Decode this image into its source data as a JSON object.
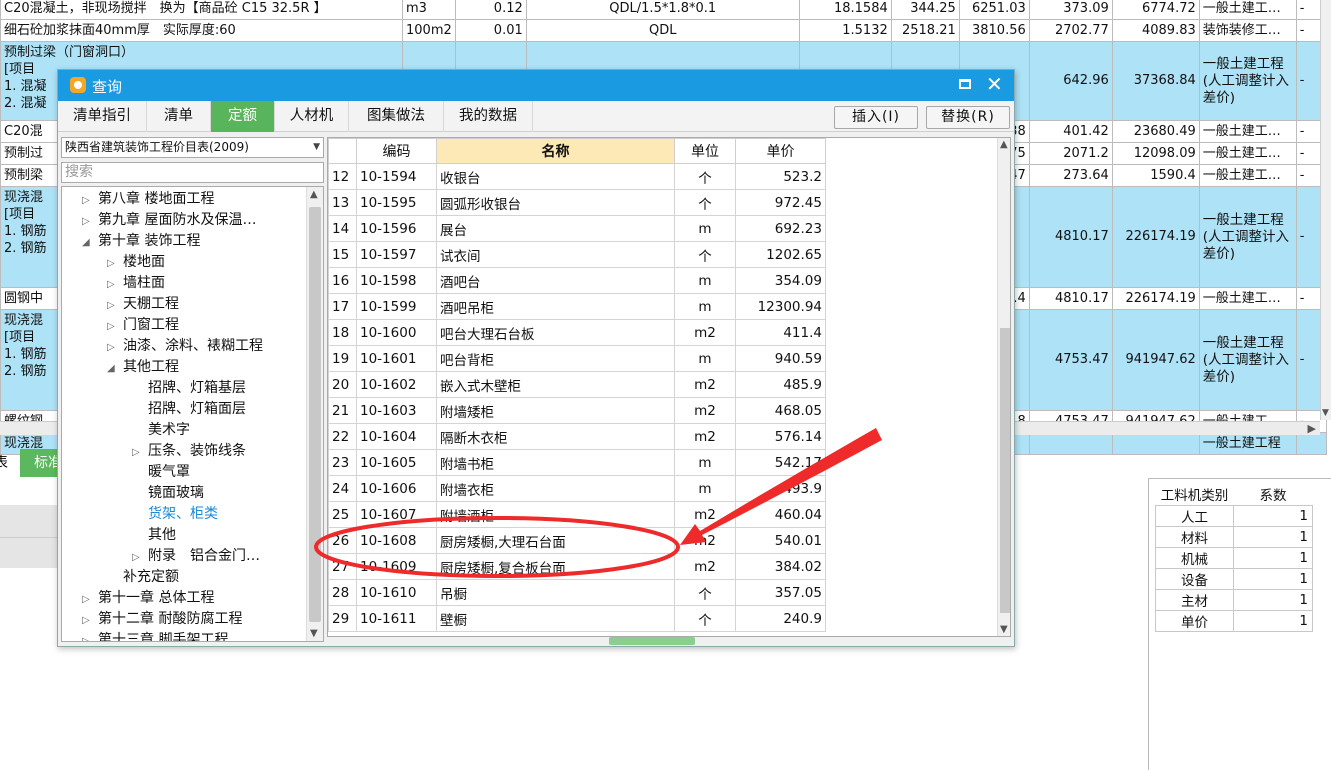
{
  "bg_rows": [
    {
      "style": "normal",
      "cols": [
        "C20混凝土，非现场搅拌　换为【商品砼 C15 32.5R 】",
        "m3",
        "0.12",
        "QDL/1.5*1.8*0.1",
        "18.1584",
        "344.25",
        "6251.03",
        "373.09",
        "6774.72",
        "一般土建工…",
        "-"
      ]
    },
    {
      "style": "normal",
      "cols": [
        "细石砼加浆抹面40mm厚　实际厚度:60",
        "100m2",
        "0.01",
        "QDL",
        "1.5132",
        "2518.21",
        "3810.56",
        "2702.77",
        "4089.83",
        "装饰装修工…",
        "-"
      ]
    },
    {
      "style": "tall",
      "cols": [
        "预制过梁（门窗洞口）\n[项目\n1. 混凝\n2. 混凝",
        "",
        "",
        "",
        "",
        "",
        "",
        "642.96",
        "37368.84",
        "一般土建工程(人工调整计入差价)",
        "-"
      ]
    },
    {
      "style": "normal",
      "cols": [
        "C20混",
        "",
        "",
        "",
        "",
        "",
        "9.38",
        "401.42",
        "23680.49",
        "一般土建工…",
        "-"
      ]
    },
    {
      "style": "normal",
      "cols": [
        "预制过",
        "",
        "",
        "",
        "",
        "",
        "2.75",
        "2071.2",
        "12098.09",
        "一般土建工…",
        "-"
      ]
    },
    {
      "style": "normal",
      "cols": [
        "预制梁",
        "",
        "",
        "",
        "",
        "",
        "7.47",
        "273.64",
        "1590.4",
        "一般土建工…",
        "-"
      ]
    },
    {
      "style": "tall2",
      "cols": [
        "现浇混\n[项目\n1. 钢筋\n2. 钢筋",
        "",
        "",
        "",
        "",
        "",
        "",
        "4810.17",
        "226174.19",
        "一般土建工程(人工调整计入差价)",
        "-"
      ]
    },
    {
      "style": "normal",
      "cols": [
        "圆钢中",
        "",
        "",
        "",
        "",
        "",
        "38.4",
        "4810.17",
        "226174.19",
        "一般土建工…",
        "-"
      ]
    },
    {
      "style": "tall2",
      "cols": [
        "现浇混\n[项目\n1. 钢筋\n2. 钢筋",
        "",
        "",
        "",
        "",
        "",
        "",
        "4753.47",
        "941947.62",
        "一般土建工程(人工调整计入差价)",
        "-"
      ]
    },
    {
      "style": "normal",
      "cols": [
        "螺纹钢",
        "",
        "",
        "",
        "",
        "",
        "25.8",
        "4753.47",
        "941947.62",
        "一般土建工…",
        "-"
      ]
    },
    {
      "style": "blue",
      "cols": [
        "现浇混",
        "",
        "",
        "",
        "",
        "",
        "",
        "",
        "",
        "一般土建工程",
        ""
      ]
    }
  ],
  "bg_tabs": [
    "表",
    "标准"
  ],
  "right_panel": {
    "headers": [
      "工料机类别",
      "系数"
    ],
    "rows": [
      {
        "type": "人工",
        "coef": "1"
      },
      {
        "type": "材料",
        "coef": "1"
      },
      {
        "type": "机械",
        "coef": "1"
      },
      {
        "type": "设备",
        "coef": "1"
      },
      {
        "type": "主材",
        "coef": "1"
      },
      {
        "type": "单价",
        "coef": "1"
      }
    ]
  },
  "dialog": {
    "title": "查询",
    "tabs": [
      "清单指引",
      "清单",
      "定额",
      "人材机",
      "图集做法",
      "我的数据"
    ],
    "active_tab": "定额",
    "insert_button": "插入(I)",
    "replace_button": "替换(R)",
    "library": "陕西省建筑装饰工程价目表(2009)",
    "search_placeholder": "搜索",
    "tree": [
      {
        "label": "第八章 楼地面工程",
        "level": 0,
        "toggle": "collapsed"
      },
      {
        "label": "第九章 屋面防水及保温…",
        "level": 0,
        "toggle": "collapsed"
      },
      {
        "label": "第十章 装饰工程",
        "level": 0,
        "toggle": "expanded"
      },
      {
        "label": "楼地面",
        "level": 1,
        "toggle": "collapsed"
      },
      {
        "label": "墙柱面",
        "level": 1,
        "toggle": "collapsed"
      },
      {
        "label": "天棚工程",
        "level": 1,
        "toggle": "collapsed"
      },
      {
        "label": "门窗工程",
        "level": 1,
        "toggle": "collapsed"
      },
      {
        "label": "油漆、涂料、裱糊工程",
        "level": 1,
        "toggle": "collapsed"
      },
      {
        "label": "其他工程",
        "level": 1,
        "toggle": "expanded"
      },
      {
        "label": "招牌、灯箱基层",
        "level": 2,
        "toggle": "none"
      },
      {
        "label": "招牌、灯箱面层",
        "level": 2,
        "toggle": "none"
      },
      {
        "label": "美术字",
        "level": 2,
        "toggle": "none"
      },
      {
        "label": "压条、装饰线条",
        "level": 2,
        "toggle": "collapsed"
      },
      {
        "label": "暖气罩",
        "level": 2,
        "toggle": "none"
      },
      {
        "label": "镜面玻璃",
        "level": 2,
        "toggle": "none"
      },
      {
        "label": "货架、柜类",
        "level": 2,
        "toggle": "none",
        "selected": true
      },
      {
        "label": "其他",
        "level": 2,
        "toggle": "none"
      },
      {
        "label": "附录　铝合金门…",
        "level": 2,
        "toggle": "collapsed"
      },
      {
        "label": "补充定额",
        "level": 1,
        "toggle": "none"
      },
      {
        "label": "第十一章 总体工程",
        "level": 0,
        "toggle": "collapsed"
      },
      {
        "label": "第十二章 耐酸防腐工程",
        "level": 0,
        "toggle": "collapsed"
      },
      {
        "label": "第十三章 脚手架工程",
        "level": 0,
        "toggle": "collapsed"
      }
    ],
    "grid": {
      "headers": [
        "",
        "编码",
        "名称",
        "单位",
        "单价"
      ],
      "rows": [
        [
          "12",
          "10-1594",
          "收银台",
          "个",
          "523.2"
        ],
        [
          "13",
          "10-1595",
          "圆弧形收银台",
          "个",
          "972.45"
        ],
        [
          "14",
          "10-1596",
          "展台",
          "m",
          "692.23"
        ],
        [
          "15",
          "10-1597",
          "试衣间",
          "个",
          "1202.65"
        ],
        [
          "16",
          "10-1598",
          "酒吧台",
          "m",
          "354.09"
        ],
        [
          "17",
          "10-1599",
          "酒吧吊柜",
          "m",
          "12300.94"
        ],
        [
          "18",
          "10-1600",
          "吧台大理石台板",
          "m2",
          "411.4"
        ],
        [
          "19",
          "10-1601",
          "吧台背柜",
          "m",
          "940.59"
        ],
        [
          "20",
          "10-1602",
          "嵌入式木壁柜",
          "m2",
          "485.9"
        ],
        [
          "21",
          "10-1603",
          "附墙矮柜",
          "m2",
          "468.05"
        ],
        [
          "22",
          "10-1604",
          "隔断木衣柜",
          "m2",
          "576.14"
        ],
        [
          "23",
          "10-1605",
          "附墙书柜",
          "m",
          "542.17"
        ],
        [
          "24",
          "10-1606",
          "附墙衣柜",
          "m",
          "493.9"
        ],
        [
          "25",
          "10-1607",
          "附墙酒柜",
          "m2",
          "460.04"
        ],
        [
          "26",
          "10-1608",
          "厨房矮橱,大理石台面",
          "m2",
          "540.01"
        ],
        [
          "27",
          "10-1609",
          "厨房矮橱,复合板台面",
          "m2",
          "384.02"
        ],
        [
          "28",
          "10-1610",
          "吊橱",
          "个",
          "357.05"
        ],
        [
          "29",
          "10-1611",
          "壁橱",
          "个",
          "240.9"
        ]
      ]
    }
  },
  "annotation": {
    "color": "#ee2a2a"
  }
}
